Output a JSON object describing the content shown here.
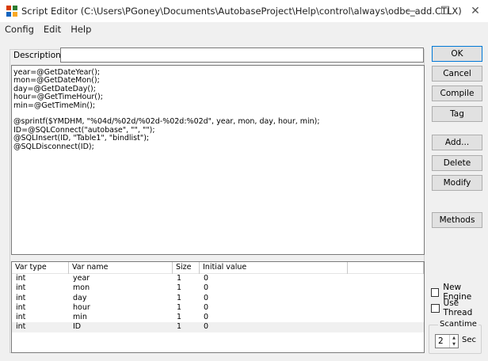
{
  "window": {
    "title": "Script Editor (C:\\Users\\PGoney\\Documents\\AutobaseProject\\Help\\control\\always\\odbc_add.CTLX)",
    "minimize": "—",
    "maximize": "☐",
    "close": "✕"
  },
  "menu": [
    "Config",
    "Edit",
    "Help"
  ],
  "description": {
    "label": "Description",
    "value": ""
  },
  "script_lines": [
    "year=@GetDateYear();",
    "mon=@GetDateMon();",
    "day=@GetDateDay();",
    "hour=@GetTimeHour();",
    "min=@GetTimeMin();",
    "",
    "@sprintf($YMDHM, \"%04d/%02d/%02d-%02d:%02d\", year, mon, day, hour, min);",
    "ID=@SQLConnect(\"autobase\", \"\", \"\");",
    "@SQLInsert(ID, \"Table1\", \"bindlist\");",
    "@SQLDisconnect(ID);"
  ],
  "variables": {
    "columns": [
      "Var type",
      "Var name",
      "Size",
      "Initial value",
      ""
    ],
    "rows": [
      [
        "int",
        "year",
        "1",
        "0"
      ],
      [
        "int",
        "mon",
        "1",
        "0"
      ],
      [
        "int",
        "day",
        "1",
        "0"
      ],
      [
        "int",
        "hour",
        "1",
        "0"
      ],
      [
        "int",
        "min",
        "1",
        "0"
      ],
      [
        "int",
        "ID",
        "1",
        "0"
      ]
    ]
  },
  "buttons": {
    "ok": "OK",
    "cancel": "Cancel",
    "compile": "Compile",
    "tag": "Tag",
    "add": "Add...",
    "delete": "Delete",
    "modify": "Modify",
    "methods": "Methods"
  },
  "options": {
    "new_engine": {
      "label": "New Engine",
      "checked": false
    },
    "use_thread": {
      "label": "Use Thread",
      "checked": false
    }
  },
  "scantime": {
    "legend": "Scantime",
    "value": "2",
    "unit": "Sec"
  }
}
